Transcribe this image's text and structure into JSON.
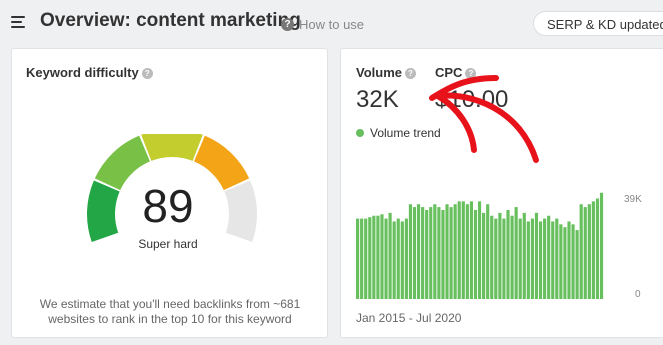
{
  "header": {
    "title": "Overview: content marketing",
    "help_label": "How to use",
    "help_icon": "question-circle-icon",
    "serp_button": "SERP & KD updated"
  },
  "kd_card": {
    "title": "Keyword difficulty",
    "value": "89",
    "label": "Super hard",
    "note": "We estimate that you'll need backlinks from ~681 websites to rank in the top 10 for this keyword",
    "score": 89,
    "segment_colors": [
      "#23a645",
      "#79c047",
      "#c4cd2e",
      "#f3a517",
      "#e6e6e6"
    ]
  },
  "volume_card": {
    "volume_label": "Volume",
    "volume_value": "32K",
    "cpc_label": "CPC",
    "cpc_value": "$10.00",
    "trend_label": "Volume trend",
    "trend_color": "#67c05d",
    "range_label": "Jan 2015 - Jul 2020",
    "y_max_label": "39K",
    "y_min_label": "0"
  },
  "chart_data": {
    "type": "bar",
    "title": "",
    "series": [
      {
        "name": "Volume trend",
        "values": [
          28,
          28,
          28,
          28.5,
          29,
          29,
          29.5,
          28,
          30,
          27,
          28,
          27,
          28,
          33,
          32,
          33,
          32,
          31,
          32,
          33,
          32,
          31,
          33,
          32,
          33,
          34,
          34,
          33,
          34,
          31,
          34,
          30,
          33,
          29,
          28,
          30,
          28,
          31,
          29,
          32,
          28,
          30,
          27,
          28,
          30,
          27,
          28,
          29,
          27,
          28,
          26,
          25,
          27,
          26,
          24,
          33,
          32,
          33,
          34,
          35,
          37
        ]
      }
    ],
    "x_range": [
      "Jan 2015",
      "Jul 2020"
    ],
    "ylim": [
      0,
      39
    ],
    "y_unit": "K",
    "y_ticks": [
      "0",
      "39K"
    ],
    "grid": false,
    "color": "#67c05d"
  }
}
